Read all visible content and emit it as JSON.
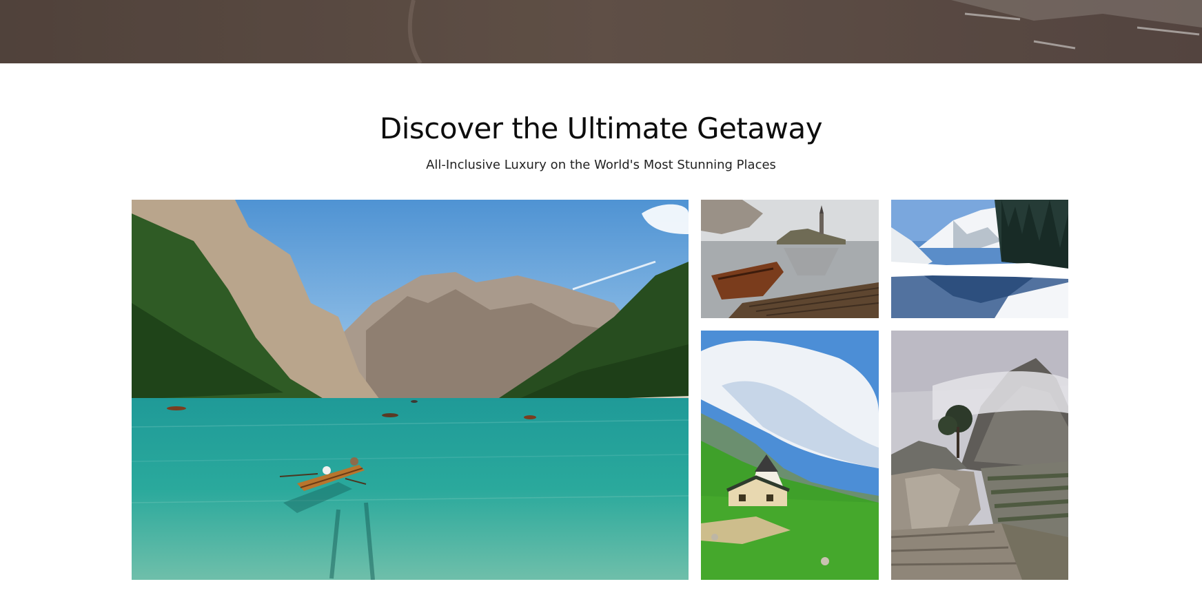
{
  "section": {
    "title": "Discover the Ultimate Getaway",
    "subtitle": "All-Inclusive Luxury on the World's Most Stunning Places"
  },
  "gallery": {
    "images": [
      {
        "name": "lake-mountains-rowboat",
        "subject": "turquoise alpine lake with rowboat"
      },
      {
        "name": "misty-lake-castle",
        "subject": "misty lake with island church and wooden boat"
      },
      {
        "name": "snowy-mountain-lake",
        "subject": "snowy mountains reflected in lake"
      },
      {
        "name": "green-valley-cabin",
        "subject": "green valley with small cabin"
      },
      {
        "name": "misty-ruins",
        "subject": "mountain ruins in clouds"
      }
    ]
  },
  "colors": {
    "hero": "#5f514a",
    "background": "#ffffff",
    "text": "#0d0d0d"
  }
}
